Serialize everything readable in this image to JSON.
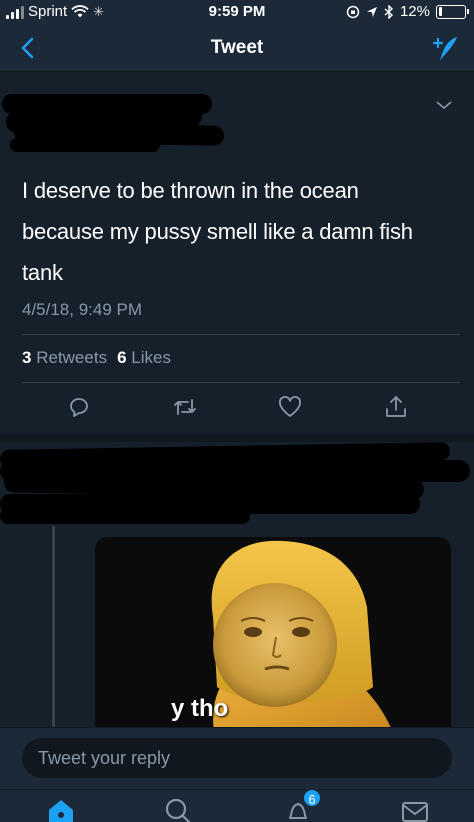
{
  "status_bar": {
    "carrier": "Sprint",
    "time": "9:59 PM",
    "battery": "12%",
    "battery_level": 0.12
  },
  "nav": {
    "title": "Tweet",
    "back_icon": "chevron-left-icon",
    "compose_icon": "compose-tweet-icon"
  },
  "tweet": {
    "text": "I deserve to be thrown in the ocean because my pussy smell like a damn fish tank",
    "timestamp": "4/5/18, 9:49 PM",
    "retweets_count": "3",
    "retweets_label": "Retweets",
    "likes_count": "6",
    "likes_label": "Likes"
  },
  "reply": {
    "media_caption": "y tho"
  },
  "reply_bar": {
    "placeholder": "Tweet your reply"
  },
  "tab_bar": {
    "notifications_badge": "6"
  },
  "colors": {
    "background": "#15202b",
    "bar": "#1c2938",
    "accent": "#1da1f2",
    "secondary_text": "#8899a6",
    "separator": "#38444d"
  }
}
